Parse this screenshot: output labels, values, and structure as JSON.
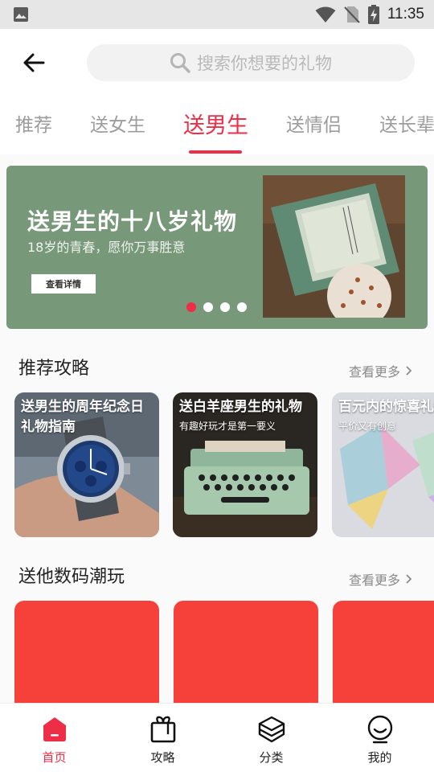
{
  "status_bar": {
    "time": "11:35"
  },
  "search": {
    "placeholder": "搜索你想要的礼物"
  },
  "tabs": [
    {
      "label": "推荐"
    },
    {
      "label": "送女生"
    },
    {
      "label": "送男生"
    },
    {
      "label": "送情侣"
    },
    {
      "label": "送长辈"
    }
  ],
  "banner": {
    "title": "送男生的十八岁礼物",
    "subtitle": "18岁的青春，愿你万事胜意",
    "button": "查看详情",
    "slide_count": 4,
    "active_slide": 1
  },
  "guides": {
    "title": "推荐攻略",
    "more": "查看更多",
    "cards": [
      {
        "title": "送男生的周年纪念日礼物指南",
        "subtitle": ""
      },
      {
        "title": "送白羊座男生的礼物",
        "subtitle": "有趣好玩才是第一要义"
      },
      {
        "title": "百元内的惊喜礼物",
        "subtitle": "平价又有创意"
      }
    ]
  },
  "digital": {
    "title": "送他数码潮玩",
    "more": "查看更多",
    "card_color": "#f5413a"
  },
  "bottom_nav": [
    {
      "label": "首页",
      "icon": "home-icon",
      "active": true
    },
    {
      "label": "攻略",
      "icon": "gift-box-icon",
      "active": false
    },
    {
      "label": "分类",
      "icon": "layers-icon",
      "active": false
    },
    {
      "label": "我的",
      "icon": "smiley-icon",
      "active": false
    }
  ],
  "colors": {
    "accent": "#ee2e47",
    "banner_bg": "#78987a"
  }
}
